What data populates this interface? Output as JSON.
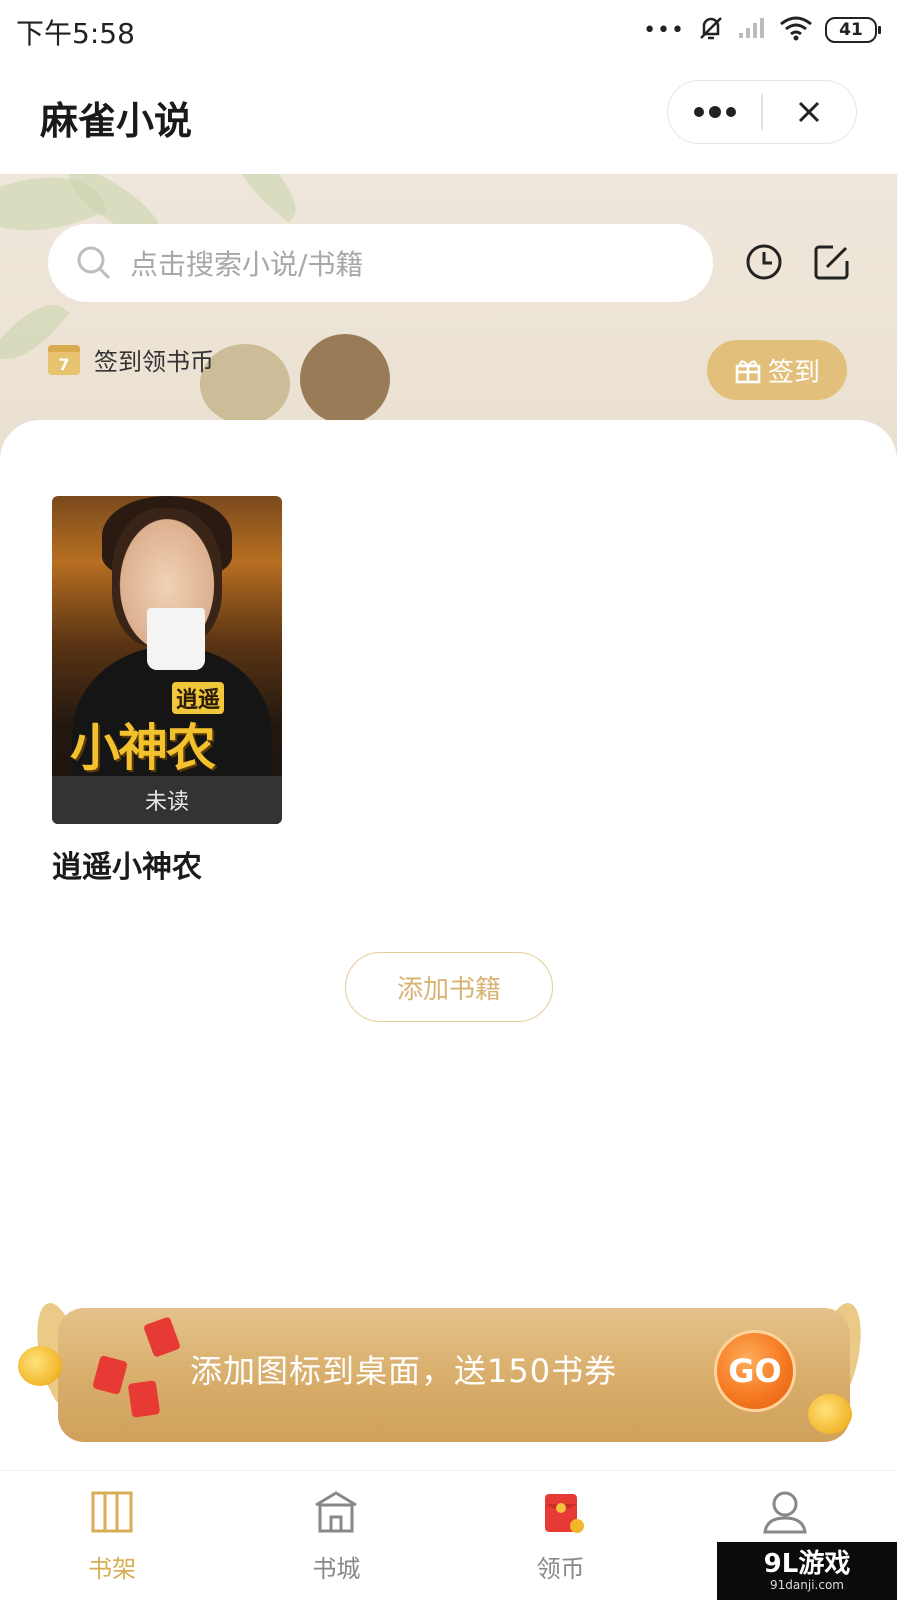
{
  "status_bar": {
    "time": "下午5:58",
    "battery": "41",
    "icons": [
      "more-dots-icon",
      "mute-icon",
      "signal-icon",
      "wifi-icon",
      "battery-icon"
    ]
  },
  "header": {
    "title": "麻雀小说",
    "more_icon": "more-dots-icon",
    "close_icon": "close-icon"
  },
  "banner": {
    "search_placeholder": "点击搜索小说/书籍",
    "history_icon": "clock-icon",
    "edit_icon": "edit-icon",
    "checkin": {
      "calendar_day": "7",
      "label": "签到领书币",
      "button_label": "签到",
      "button_icon": "gift-icon"
    }
  },
  "shelf": {
    "books": [
      {
        "title": "逍遥小神农",
        "cover_small_text": "逍遥",
        "cover_big_text": "小神农",
        "status": "未读"
      }
    ],
    "add_button": "添加书籍"
  },
  "promo": {
    "text": "添加图标到桌面，送150书券",
    "go_label": "GO"
  },
  "tabbar": {
    "items": [
      {
        "label": "书架",
        "icon": "bookshelf-icon",
        "active": true
      },
      {
        "label": "书城",
        "icon": "bookstore-icon",
        "active": false
      },
      {
        "label": "领币",
        "icon": "red-envelope-icon",
        "active": false
      },
      {
        "label": "",
        "icon": "user-icon",
        "active": false
      }
    ]
  },
  "watermark": {
    "main": "9L游戏",
    "sub": "91danji.com"
  },
  "colors": {
    "accent_gold": "#e2c07c",
    "tab_active": "#d9ad56",
    "go_orange": "#f57a22"
  }
}
